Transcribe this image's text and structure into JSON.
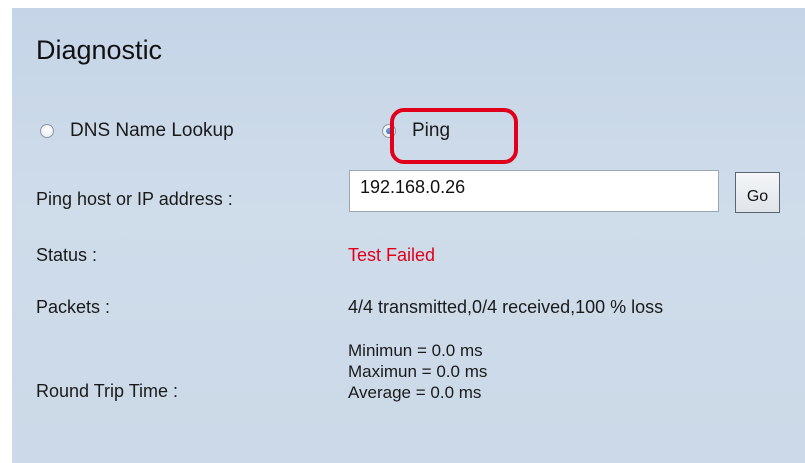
{
  "title": "Diagnostic",
  "options": {
    "dns_label": "DNS Name Lookup",
    "ping_label": "Ping",
    "selected": "Ping"
  },
  "host": {
    "label": "Ping host or IP address :",
    "value": "192.168.0.26"
  },
  "go_label": "Go",
  "status": {
    "label": "Status :",
    "value": "Test Failed",
    "color": "#e1001c"
  },
  "packets": {
    "label": "Packets :",
    "value": "4/4 transmitted,0/4 received,100 % loss"
  },
  "rtt": {
    "label": "Round Trip Time :",
    "minimum": "Minimun = 0.0 ms",
    "maximum": "Maximun = 0.0 ms",
    "average": "Average = 0.0 ms"
  },
  "highlight_color": "#e1001c"
}
